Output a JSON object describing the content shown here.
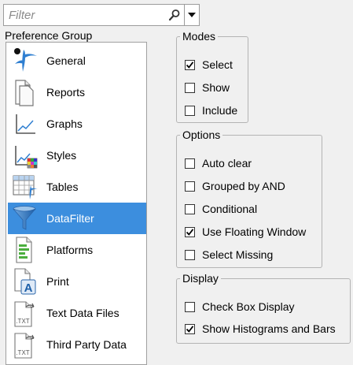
{
  "filter": {
    "placeholder": "Filter"
  },
  "preference_group": {
    "title": "Preference Group",
    "items": [
      {
        "label": "General",
        "icon": "general-icon",
        "selected": false
      },
      {
        "label": "Reports",
        "icon": "reports-icon",
        "selected": false
      },
      {
        "label": "Graphs",
        "icon": "graphs-icon",
        "selected": false
      },
      {
        "label": "Styles",
        "icon": "styles-icon",
        "selected": false
      },
      {
        "label": "Tables",
        "icon": "tables-icon",
        "selected": false
      },
      {
        "label": "DataFilter",
        "icon": "funnel-icon",
        "selected": true
      },
      {
        "label": "Platforms",
        "icon": "platforms-icon",
        "selected": false
      },
      {
        "label": "Print",
        "icon": "print-icon",
        "selected": false
      },
      {
        "label": "Text Data Files",
        "icon": "txt-file-icon",
        "selected": false
      },
      {
        "label": "Third Party Data",
        "icon": "txt-file-icon",
        "selected": false
      }
    ]
  },
  "modes": {
    "title": "Modes",
    "options": [
      {
        "label": "Select",
        "checked": true
      },
      {
        "label": "Show",
        "checked": false
      },
      {
        "label": "Include",
        "checked": false
      }
    ]
  },
  "options": {
    "title": "Options",
    "options": [
      {
        "label": "Auto clear",
        "checked": false
      },
      {
        "label": "Grouped by AND",
        "checked": false
      },
      {
        "label": "Conditional",
        "checked": false
      },
      {
        "label": "Use Floating Window",
        "checked": true
      },
      {
        "label": "Select Missing",
        "checked": false
      }
    ]
  },
  "display": {
    "title": "Display",
    "options": [
      {
        "label": "Check Box Display",
        "checked": false
      },
      {
        "label": "Show Histograms and Bars",
        "checked": true
      }
    ]
  },
  "colors": {
    "selection": "#3c8ede",
    "border": "#b4b4b4",
    "background": "#f0f0f0"
  }
}
